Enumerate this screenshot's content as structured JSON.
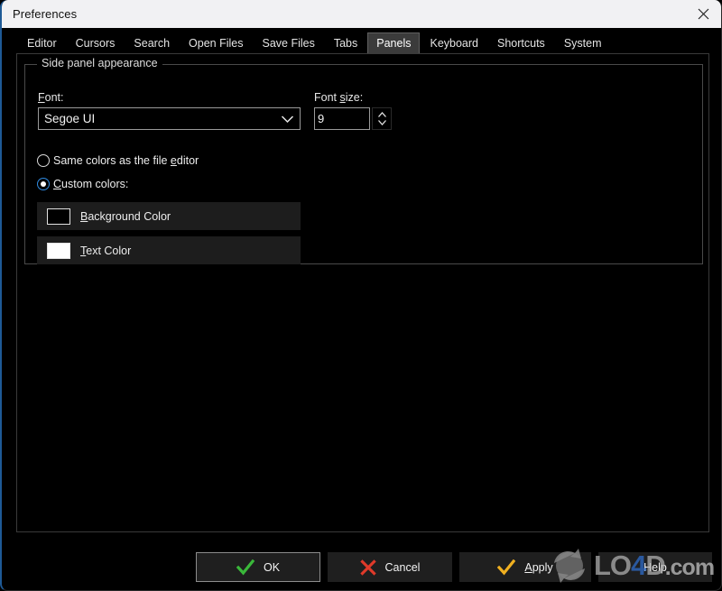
{
  "window": {
    "title": "Preferences",
    "close_icon": "close-icon",
    "accent_color": "#1e5a96",
    "titlebar_bg": "#f1f1f3",
    "body_bg": "#000000"
  },
  "tabs": {
    "items": [
      {
        "label": "Editor",
        "selected": false
      },
      {
        "label": "Cursors",
        "selected": false
      },
      {
        "label": "Search",
        "selected": false
      },
      {
        "label": "Open Files",
        "selected": false
      },
      {
        "label": "Save Files",
        "selected": false
      },
      {
        "label": "Tabs",
        "selected": false
      },
      {
        "label": "Panels",
        "selected": true
      },
      {
        "label": "Keyboard",
        "selected": false
      },
      {
        "label": "Shortcuts",
        "selected": false
      },
      {
        "label": "System",
        "selected": false
      }
    ],
    "selected": "Panels"
  },
  "panels_page": {
    "group_title": "Side panel appearance",
    "font": {
      "label": "Font:",
      "mnemonic": "F",
      "value": "Segoe UI",
      "arrow_icon": "chevron-down-icon"
    },
    "font_size": {
      "label": "Font size:",
      "mnemonic": "s",
      "value": "9",
      "spinner_icon": "spinner-updown-icon"
    },
    "color_mode": {
      "options": [
        {
          "label": "Same colors as the file editor",
          "mnemonic": "e",
          "selected": false
        },
        {
          "label": "Custom colors:",
          "mnemonic": "C",
          "selected": true
        }
      ],
      "selected": "Custom colors:"
    },
    "color_buttons": [
      {
        "label": "Background Color",
        "mnemonic": "B",
        "swatch": "#000000"
      },
      {
        "label": "Text Color",
        "mnemonic": "T",
        "swatch": "#ffffff"
      }
    ]
  },
  "footer": {
    "buttons": [
      {
        "label": "OK",
        "icon": "check-green-icon",
        "icon_color": "#3ab83a",
        "focused": true
      },
      {
        "label": "Cancel",
        "icon": "cross-red-icon",
        "icon_color": "#e03a2a",
        "focused": false
      },
      {
        "label": "Apply",
        "icon": "check-yellow-icon",
        "icon_color": "#f0b020",
        "focused": false,
        "mnemonic": "A"
      },
      {
        "label": "Help",
        "icon": "none",
        "icon_color": "",
        "focused": false
      }
    ]
  },
  "watermark": {
    "prefix": "LO",
    "accent": "4",
    "middle": "D",
    "suffix": ".com",
    "logo_icon": "refresh-circle-icon"
  }
}
